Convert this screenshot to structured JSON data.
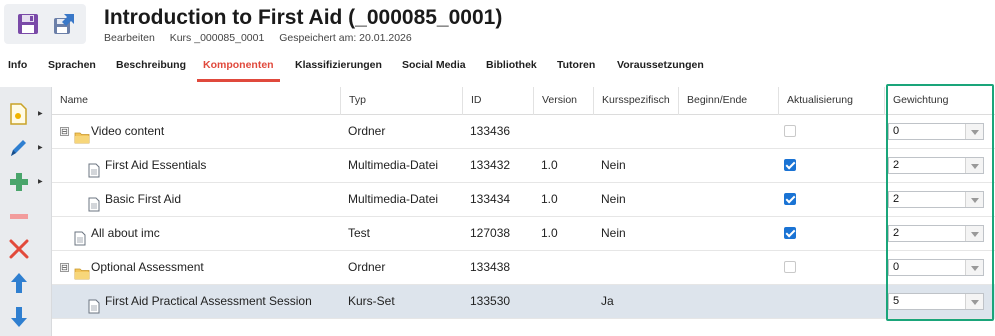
{
  "header": {
    "title": "Introduction to First Aid (_000085_0001)",
    "meta": [
      "Bearbeiten",
      "Kurs _000085_0001",
      "Gespeichert am: 20.01.2026"
    ],
    "icons": [
      "save-icon",
      "save-as-icon"
    ]
  },
  "tabs": [
    {
      "label": "Info"
    },
    {
      "label": "Sprachen"
    },
    {
      "label": "Beschreibung"
    },
    {
      "label": "Komponenten",
      "active": true
    },
    {
      "label": "Klassifizierungen"
    },
    {
      "label": "Social Media"
    },
    {
      "label": "Bibliothek"
    },
    {
      "label": "Tutoren"
    },
    {
      "label": "Voraussetzungen"
    }
  ],
  "toolbar": [
    "new-component-icon",
    "edit-icon",
    "add-icon",
    "remove-icon",
    "delete-icon",
    "move-up-icon",
    "move-down-icon"
  ],
  "columns": [
    "Name",
    "Typ",
    "ID",
    "Version",
    "Kursspezifisch",
    "Beginn/Ende",
    "Aktualisierung",
    "Gewichtung"
  ],
  "rows": [
    {
      "name": "Video content",
      "type": "Ordner",
      "id": "133436",
      "version": "",
      "specific": "",
      "dates": "",
      "update": "disabled",
      "weight": "0",
      "level": 0,
      "kind": "folder",
      "expander": "⊟"
    },
    {
      "name": "First Aid Essentials",
      "type": "Multimedia-Datei",
      "id": "133432",
      "version": "1.0",
      "specific": "Nein",
      "dates": "",
      "update": "checked",
      "weight": "2",
      "level": 1,
      "kind": "file"
    },
    {
      "name": "Basic First Aid",
      "type": "Multimedia-Datei",
      "id": "133434",
      "version": "1.0",
      "specific": "Nein",
      "dates": "",
      "update": "checked",
      "weight": "2",
      "level": 1,
      "kind": "file"
    },
    {
      "name": "All about imc",
      "type": "Test",
      "id": "127038",
      "version": "1.0",
      "specific": "Nein",
      "dates": "",
      "update": "checked",
      "weight": "2",
      "level": 0,
      "kind": "file"
    },
    {
      "name": "Optional Assessment",
      "type": "Ordner",
      "id": "133438",
      "version": "",
      "specific": "",
      "dates": "",
      "update": "disabled",
      "weight": "0",
      "level": 0,
      "kind": "folder",
      "expander": "⊟"
    },
    {
      "name": "First Aid Practical Assessment Session",
      "type": "Kurs-Set",
      "id": "133530",
      "version": "",
      "specific": "Ja",
      "dates": "",
      "update": "none",
      "weight": "5",
      "level": 1,
      "kind": "file",
      "selected": true
    }
  ],
  "colors": {
    "accent": "#e0493c",
    "checkbox": "#1a73d4",
    "highlight": "#1aa57a",
    "selected_row": "#dde4ec"
  }
}
